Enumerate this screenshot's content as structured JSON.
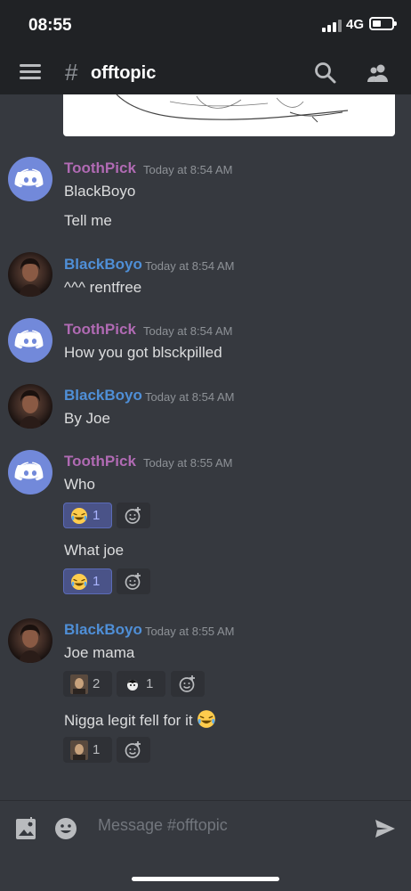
{
  "status_bar": {
    "time": "08:55",
    "network": "4G"
  },
  "header": {
    "channel": "offtopic",
    "hash": "#"
  },
  "colors": {
    "toothpick": "#b06ab3",
    "blackboyo": "#4f8fd7",
    "accent": "#7289da",
    "background": "#36393f"
  },
  "messages": [
    {
      "author": "ToothPick",
      "timestamp": "Today at 8:54 AM",
      "lines": [
        "BlackBoyo",
        "Tell me"
      ]
    },
    {
      "author": "BlackBoyo",
      "timestamp": "Today at 8:54 AM",
      "lines": [
        "^^^ rentfree"
      ]
    },
    {
      "author": "ToothPick",
      "timestamp": "Today at 8:54 AM",
      "lines": [
        "How you got blsckpilled"
      ]
    },
    {
      "author": "BlackBoyo",
      "timestamp": "Today at 8:54 AM",
      "lines": [
        "By Joe"
      ]
    },
    {
      "author": "ToothPick",
      "timestamp": "Today at 8:55 AM",
      "lines": [
        "Who",
        "What joe"
      ],
      "reactions": [
        {
          "emoji": "joy-emoji",
          "count": "1"
        },
        {
          "emoji": "joy-emoji",
          "count": "1"
        }
      ]
    },
    {
      "author": "BlackBoyo",
      "timestamp": "Today at 8:55 AM",
      "lines": [
        "Joe mama",
        "Nigga legit fell for it"
      ],
      "reactions": [
        {
          "emoji": "custom-face-emoji",
          "count": "2"
        },
        {
          "emoji": "custom-face-emoji",
          "count": "1"
        },
        {
          "emoji": "custom-face-emoji",
          "count": "1"
        }
      ]
    }
  ],
  "composer": {
    "placeholder": "Message #offtopic"
  },
  "icons": [
    "menu-icon",
    "search-icon",
    "members-icon",
    "image-icon",
    "emoji-icon",
    "send-icon",
    "add-reaction-icon"
  ]
}
